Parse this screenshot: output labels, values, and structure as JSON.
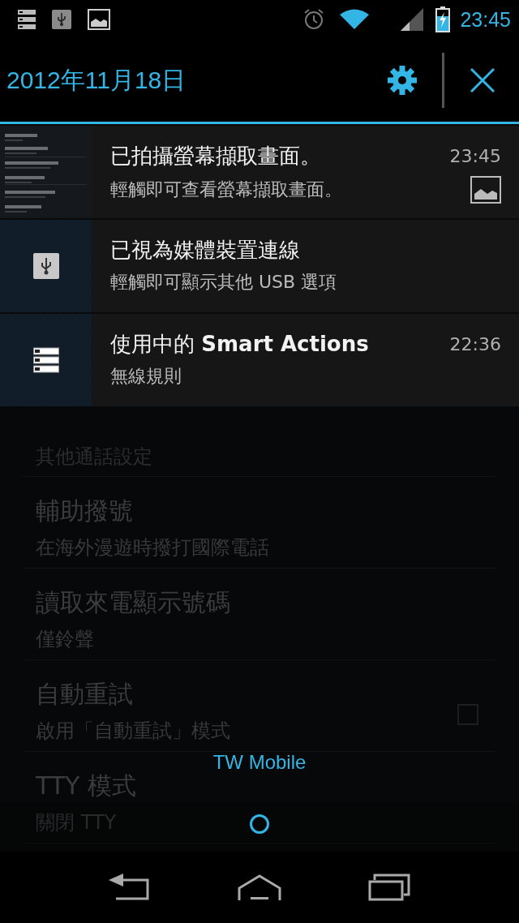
{
  "status_bar": {
    "time": "23:45"
  },
  "shade": {
    "date": "2012年11月18日",
    "notifications": [
      {
        "kind": "screenshot",
        "title": "已拍攝螢幕擷取畫面。",
        "text": "輕觸即可查看螢幕擷取畫面。",
        "time": "23:45",
        "small_icon": true
      },
      {
        "kind": "usb",
        "title": "已視為媒體裝置連線",
        "text": "輕觸即可顯示其他 USB 選項",
        "small_icon": false
      },
      {
        "kind": "list",
        "title": "使用中的 **Smart Actions**",
        "text": "無線規則",
        "time": "22:36",
        "small_icon": false
      }
    ],
    "carrier": "TW Mobile"
  },
  "settings": [
    {
      "kind": "header",
      "title": "其他通話設定"
    },
    {
      "kind": "item",
      "title": "輔助撥號",
      "summary": "在海外漫遊時撥打國際電話"
    },
    {
      "kind": "item",
      "title": "讀取來電顯示號碼",
      "summary": "僅鈴聲"
    },
    {
      "kind": "checkbox",
      "title": "自動重試",
      "summary": "啟用「自動重試」模式",
      "checked": false
    },
    {
      "kind": "item",
      "title": "TTY 模式",
      "summary": "關閉 TTY"
    }
  ]
}
